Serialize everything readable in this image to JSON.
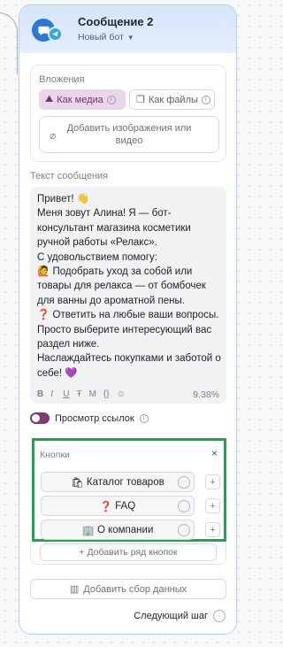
{
  "header": {
    "title": "Сообщение 2",
    "subtitle": "Новый бот",
    "avatar_icon": "chat-bubble-icon",
    "channel_icon": "telegram-icon",
    "accent": "#2c79d4"
  },
  "attachments": {
    "label": "Вложения",
    "media_button": "Как медиа",
    "files_button": "Как файлы",
    "add_images_button": "Добавить изображения или видео"
  },
  "message": {
    "label": "Текст сообщения",
    "text": "Привет! 👋\nМеня зовут Алина! Я — бот-консультант магазина косметики ручной работы «Релакс».\nС удовольствием помогу:\n🙋 Подобрать уход за собой или товары для релакса — от бомбочек для ванны до ароматной пены.\n❓ Ответить на любые ваши вопросы.\nПросто выберите интересующий вас раздел ниже.\nНаслаждайтесь покупками и заботой о себе! 💜",
    "toolbar": [
      "B",
      "I",
      "U",
      "Ŧ",
      "M",
      "{}",
      "☺"
    ],
    "usage_percent": "9.38%"
  },
  "link_preview": {
    "label": "Просмотр ссылок",
    "enabled": true
  },
  "keyboard": {
    "label": "Кнопки",
    "close": "×",
    "buttons": [
      {
        "emoji": "🛍",
        "label": "Каталог товаров"
      },
      {
        "emoji": "❓",
        "label": "FAQ"
      },
      {
        "emoji": "🏢",
        "label": "О компании"
      }
    ],
    "plus": "+",
    "add_row": "+ Добавить ряд кнопок"
  },
  "footer": {
    "add_data": "Добавить сбор данных",
    "next_step": "Следующий шаг"
  },
  "colors": {
    "highlight_border": "#23a34f",
    "toggle": "#7c3c6f",
    "media_bg": "#ecd4ec"
  }
}
